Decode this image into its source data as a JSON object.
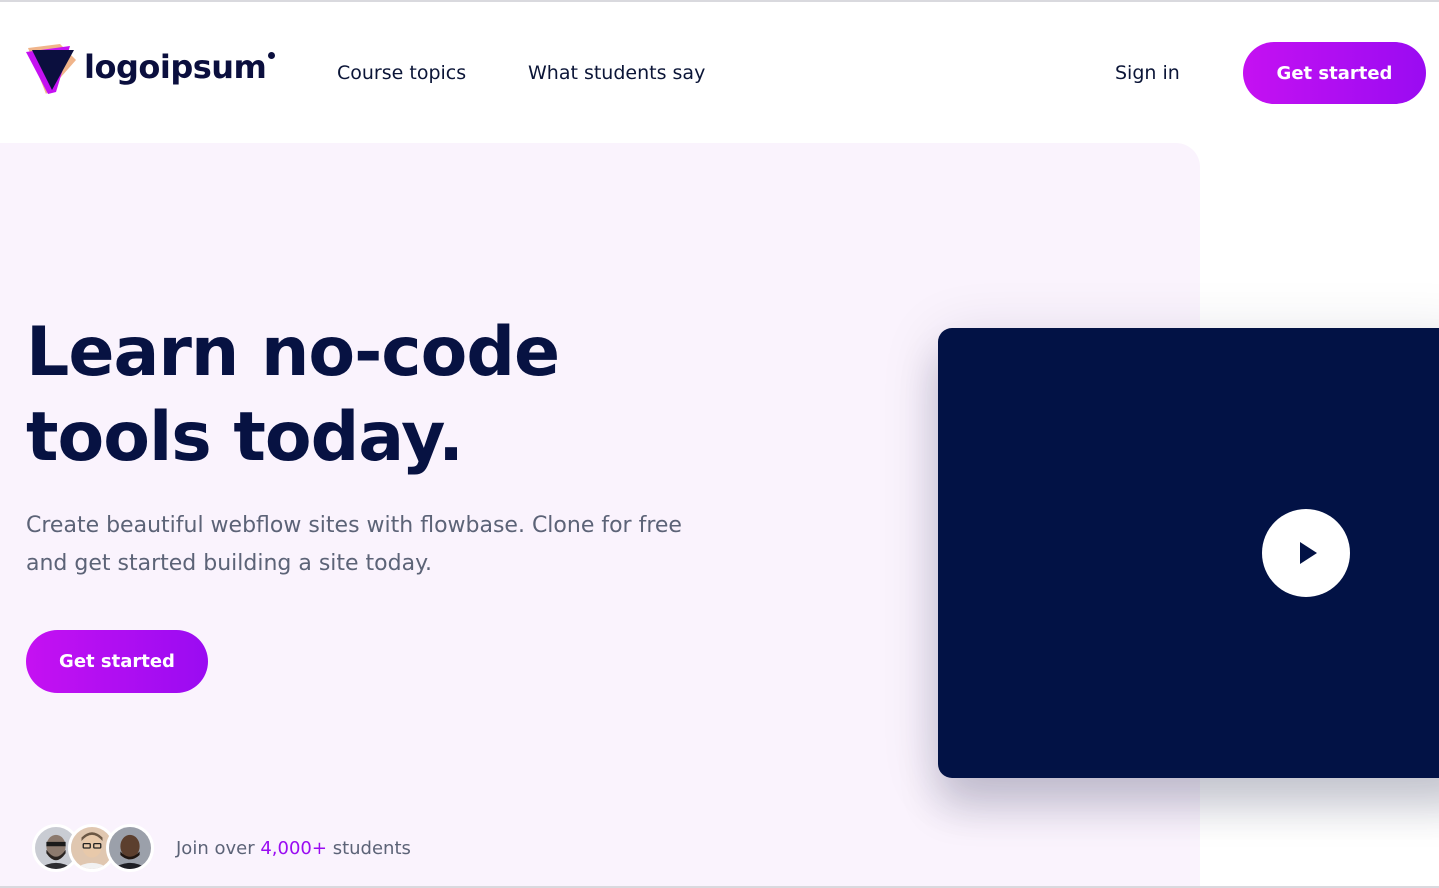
{
  "header": {
    "logo_text": "logoipsum",
    "nav": {
      "course_topics": "Course topics",
      "what_students_say": "What students say"
    },
    "sign_in": "Sign in",
    "cta": "Get started"
  },
  "hero": {
    "title_line1": "Learn no-code",
    "title_line2": "tools today.",
    "subtitle_line1": "Create beautiful webflow sites with flowbase. Clone for free",
    "subtitle_line2": "and get started building a site today.",
    "cta": "Get started"
  },
  "students": {
    "prefix": "Join over",
    "count": "4,000+",
    "suffix": "students"
  },
  "video": {
    "icon": "play-icon"
  },
  "colors": {
    "brand_purple": "#c511f2",
    "navy": "#071242",
    "hero_background": "#faf3fd",
    "video_background": "#021245"
  }
}
